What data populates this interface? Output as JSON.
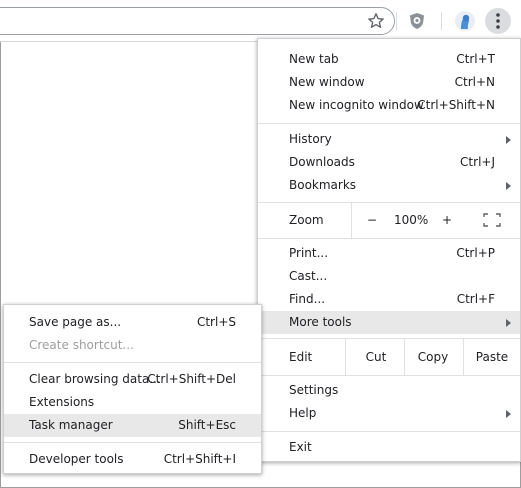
{
  "toolbar": {
    "icons": [
      "star-icon",
      "extension-shield-icon",
      "profile-avatar-icon",
      "more-menu-icon"
    ]
  },
  "main_menu": {
    "group1": [
      {
        "label": "New tab",
        "shortcut": "Ctrl+T"
      },
      {
        "label": "New window",
        "shortcut": "Ctrl+N"
      },
      {
        "label": "New incognito window",
        "shortcut": "Ctrl+Shift+N"
      }
    ],
    "group2": [
      {
        "label": "History",
        "shortcut": ""
      },
      {
        "label": "Downloads",
        "shortcut": "Ctrl+J"
      },
      {
        "label": "Bookmarks",
        "shortcut": ""
      }
    ],
    "zoom": {
      "label": "Zoom",
      "minus": "−",
      "value": "100%",
      "plus": "+"
    },
    "group3": [
      {
        "label": "Print...",
        "shortcut": "Ctrl+P"
      },
      {
        "label": "Cast...",
        "shortcut": ""
      },
      {
        "label": "Find...",
        "shortcut": "Ctrl+F"
      },
      {
        "label": "More tools",
        "shortcut": ""
      }
    ],
    "edit": {
      "label": "Edit",
      "cut": "Cut",
      "copy": "Copy",
      "paste": "Paste"
    },
    "group4": [
      {
        "label": "Settings"
      },
      {
        "label": "Help"
      }
    ],
    "exit": "Exit"
  },
  "sub_menu": {
    "group1": [
      {
        "label": "Save page as...",
        "shortcut": "Ctrl+S"
      },
      {
        "label": "Create shortcut...",
        "shortcut": ""
      }
    ],
    "group2": [
      {
        "label": "Clear browsing data...",
        "shortcut": "Ctrl+Shift+Del"
      },
      {
        "label": "Extensions",
        "shortcut": ""
      },
      {
        "label": "Task manager",
        "shortcut": "Shift+Esc"
      }
    ],
    "group3": [
      {
        "label": "Developer tools",
        "shortcut": "Ctrl+Shift+I"
      }
    ]
  },
  "colors": {
    "highlight": "#e8e8e8",
    "menu_text": "#202124",
    "disabled_text": "#9e9e9e"
  }
}
